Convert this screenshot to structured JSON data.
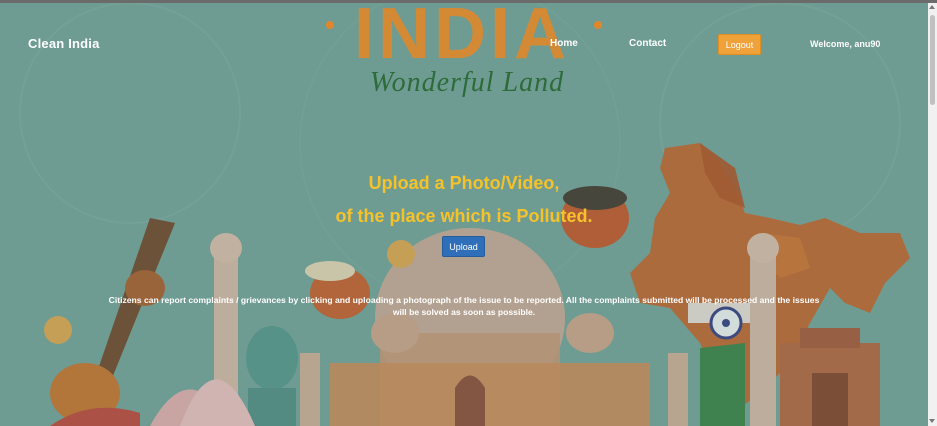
{
  "banner": {
    "title": "INDIA",
    "subtitle": "Wonderful Land"
  },
  "navbar": {
    "brand": "Clean India",
    "links": [
      {
        "label": "Home"
      },
      {
        "label": "Contact"
      }
    ],
    "logout_label": "Logout",
    "welcome_text": "Welcome, anu90"
  },
  "hero": {
    "heading_line1": "Upload a Photo/Video,",
    "heading_line2": "of the place which is Polluted.",
    "upload_label": "Upload",
    "description": "Citizens can report complaints / grievances by clicking and uploading a photograph of the issue to be reported. All the complaints submitted will be processed and the issues will be solved as soon as possible."
  },
  "colors": {
    "background": "#6f9c92",
    "accent_yellow": "#f6c22a",
    "logout_orange": "#f0a23a",
    "upload_blue": "#2f6fba"
  }
}
